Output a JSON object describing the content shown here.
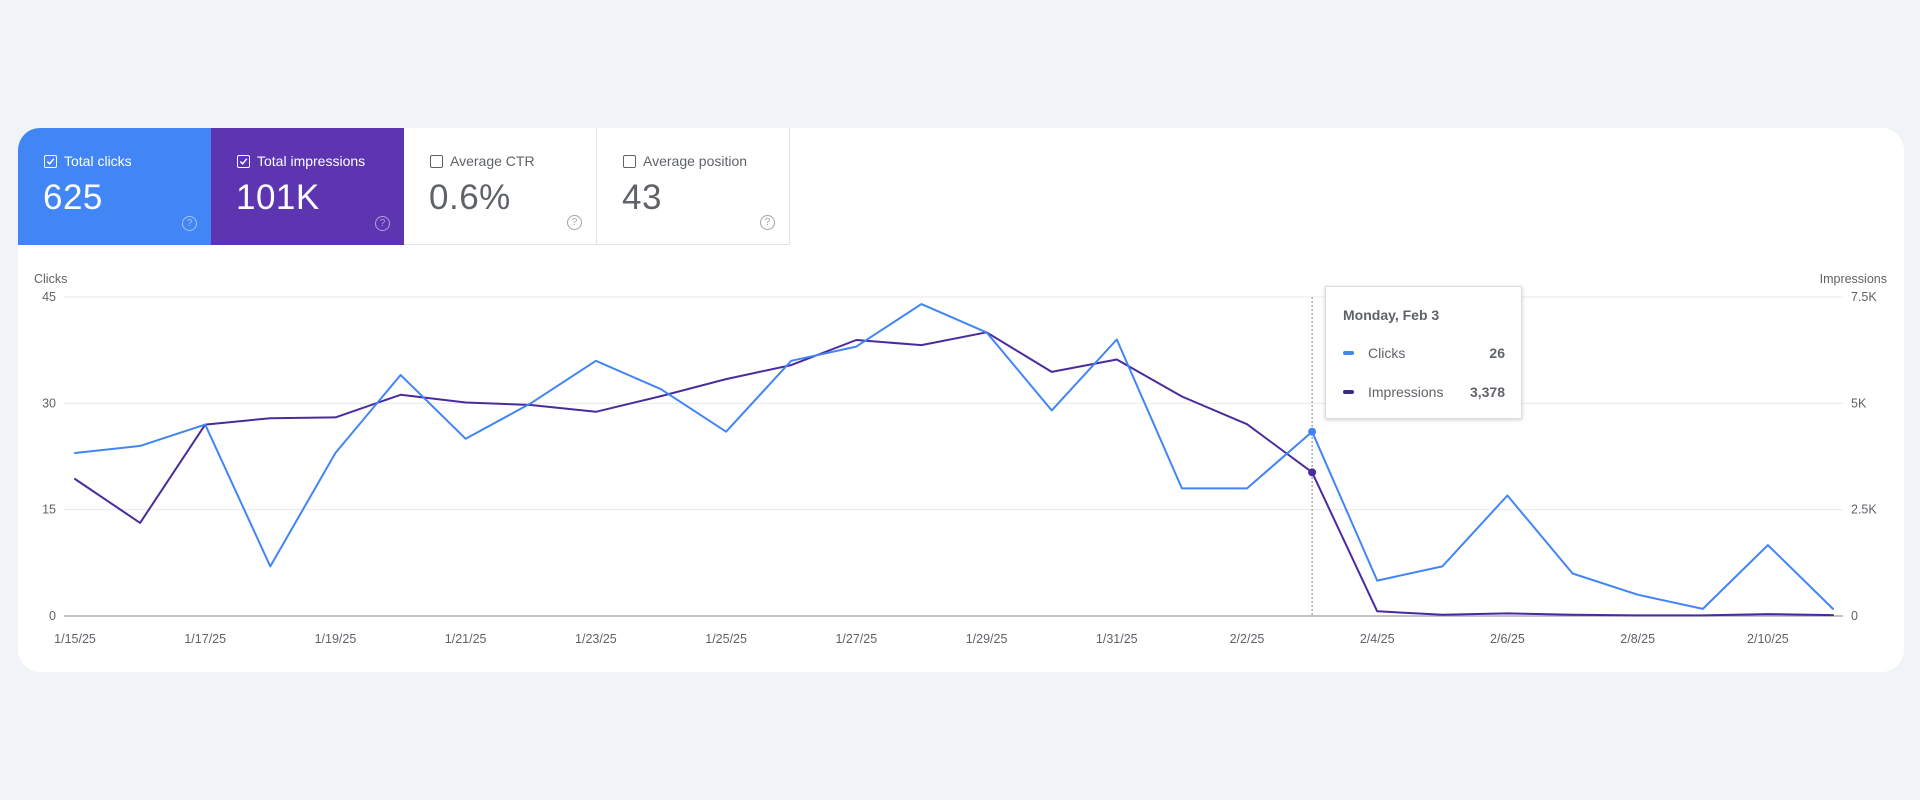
{
  "colors": {
    "clicks": "#4285f4",
    "impressions": "#5e35b1",
    "background": "#f0f3f8"
  },
  "metrics": [
    {
      "id": "clicks",
      "label": "Total clicks",
      "value": "625",
      "checked": true,
      "help_icon": "help-circle-icon"
    },
    {
      "id": "impressions",
      "label": "Total impressions",
      "value": "101K",
      "checked": true,
      "help_icon": "help-circle-icon"
    },
    {
      "id": "ctr",
      "label": "Average CTR",
      "value": "0.6%",
      "checked": false,
      "help_icon": "help-circle-icon"
    },
    {
      "id": "position",
      "label": "Average position",
      "value": "43",
      "checked": false,
      "help_icon": "help-circle-icon"
    }
  ],
  "tooltip": {
    "title": "Monday, Feb 3",
    "rows": [
      {
        "name": "Clicks",
        "value": "26"
      },
      {
        "name": "Impressions",
        "value": "3,378"
      }
    ]
  },
  "chart_data": {
    "type": "line",
    "title": "",
    "x": [
      "1/15/25",
      "1/16/25",
      "1/17/25",
      "1/18/25",
      "1/19/25",
      "1/20/25",
      "1/21/25",
      "1/22/25",
      "1/23/25",
      "1/24/25",
      "1/25/25",
      "1/26/25",
      "1/27/25",
      "1/28/25",
      "1/29/25",
      "1/30/25",
      "1/31/25",
      "2/1/25",
      "2/2/25",
      "2/3/25",
      "2/4/25",
      "2/5/25",
      "2/6/25",
      "2/7/25",
      "2/8/25",
      "2/9/25",
      "2/10/25",
      "2/11/25"
    ],
    "x_tick_labels": [
      "1/15/25",
      "1/17/25",
      "1/19/25",
      "1/21/25",
      "1/23/25",
      "1/25/25",
      "1/27/25",
      "1/29/25",
      "1/31/25",
      "2/2/25",
      "2/4/25",
      "2/6/25",
      "2/8/25",
      "2/10/25"
    ],
    "series": [
      {
        "name": "Clicks",
        "axis": "left",
        "values": [
          23,
          24,
          27,
          7,
          23,
          34,
          25,
          30,
          36,
          32,
          26,
          36,
          38,
          44,
          40,
          29,
          39,
          18,
          18,
          26,
          5,
          7,
          17,
          6,
          3,
          1,
          10,
          1
        ]
      },
      {
        "name": "Impressions",
        "axis": "right",
        "values": [
          3220,
          2190,
          4500,
          4650,
          4670,
          5200,
          5020,
          4960,
          4800,
          5170,
          5570,
          5900,
          6490,
          6370,
          6670,
          5740,
          6030,
          5160,
          4510,
          3378,
          110,
          30,
          60,
          30,
          15,
          15,
          45,
          20
        ]
      }
    ],
    "ylabel_left": "Clicks",
    "ylabel_right": "Impressions",
    "ylim_left": [
      0,
      45
    ],
    "ylim_right": [
      0,
      7500
    ],
    "yticks_left": [
      "0",
      "15",
      "30",
      "45"
    ],
    "yticks_right": [
      "0",
      "2.5K",
      "5K",
      "7.5K"
    ],
    "yticks_left_values": [
      0,
      15,
      30,
      45
    ],
    "yticks_right_values": [
      0,
      2500,
      5000,
      7500
    ],
    "grid": true,
    "hover_index": 19,
    "legend": "none"
  }
}
